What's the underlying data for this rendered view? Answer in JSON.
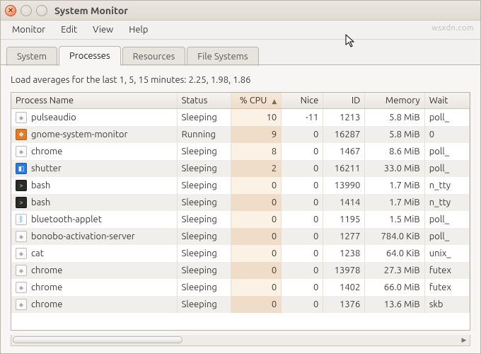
{
  "window": {
    "title": "System Monitor"
  },
  "menubar": {
    "items": [
      "Monitor",
      "Edit",
      "View",
      "Help"
    ]
  },
  "tabs": {
    "items": [
      "System",
      "Processes",
      "Resources",
      "File Systems"
    ],
    "active_index": 1
  },
  "load_avg": {
    "label_prefix": "Load averages for the last 1, 5, 15 minutes:",
    "values": "2.25, 1.98, 1.86"
  },
  "columns": {
    "name": "Process Name",
    "status": "Status",
    "cpu": "% CPU",
    "nice": "Nice",
    "id": "ID",
    "memory": "Memory",
    "wait": "Wait"
  },
  "sort": {
    "column": "cpu",
    "direction": "asc",
    "arrow": "▲"
  },
  "processes": [
    {
      "icon": "exec",
      "name": "pulseaudio",
      "status": "Sleeping",
      "cpu": 10,
      "nice": -11,
      "id": 1213,
      "memory": "5.8 MiB",
      "wait": "poll_"
    },
    {
      "icon": "app-orange",
      "name": "gnome-system-monitor",
      "status": "Running",
      "cpu": 9,
      "nice": 0,
      "id": 16287,
      "memory": "5.8 MiB",
      "wait": "0"
    },
    {
      "icon": "exec",
      "name": "chrome",
      "status": "Sleeping",
      "cpu": 8,
      "nice": 0,
      "id": 1467,
      "memory": "8.6 MiB",
      "wait": "poll_"
    },
    {
      "icon": "app-blue",
      "name": "shutter",
      "status": "Sleeping",
      "cpu": 2,
      "nice": 0,
      "id": 16211,
      "memory": "33.0 MiB",
      "wait": "poll_"
    },
    {
      "icon": "term",
      "name": "bash",
      "status": "Sleeping",
      "cpu": 0,
      "nice": 0,
      "id": 13990,
      "memory": "1.7 MiB",
      "wait": "n_tty"
    },
    {
      "icon": "term",
      "name": "bash",
      "status": "Sleeping",
      "cpu": 0,
      "nice": 0,
      "id": 1414,
      "memory": "1.7 MiB",
      "wait": "n_tty"
    },
    {
      "icon": "bt",
      "name": "bluetooth-applet",
      "status": "Sleeping",
      "cpu": 0,
      "nice": 0,
      "id": 1195,
      "memory": "1.5 MiB",
      "wait": "poll_"
    },
    {
      "icon": "exec",
      "name": "bonobo-activation-server",
      "status": "Sleeping",
      "cpu": 0,
      "nice": 0,
      "id": 1277,
      "memory": "784.0 KiB",
      "wait": "poll_"
    },
    {
      "icon": "exec",
      "name": "cat",
      "status": "Sleeping",
      "cpu": 0,
      "nice": 0,
      "id": 1238,
      "memory": "64.0 KiB",
      "wait": "unix_"
    },
    {
      "icon": "exec",
      "name": "chrome",
      "status": "Sleeping",
      "cpu": 0,
      "nice": 0,
      "id": 13978,
      "memory": "27.3 MiB",
      "wait": "futex"
    },
    {
      "icon": "exec",
      "name": "chrome",
      "status": "Sleeping",
      "cpu": 0,
      "nice": 0,
      "id": 1402,
      "memory": "66.0 MiB",
      "wait": "futex"
    },
    {
      "icon": "exec",
      "name": "chrome",
      "status": "Sleeping",
      "cpu": 0,
      "nice": 0,
      "id": 1376,
      "memory": "13.6 MiB",
      "wait": "skb"
    }
  ],
  "watermark": "wsxdn.com"
}
